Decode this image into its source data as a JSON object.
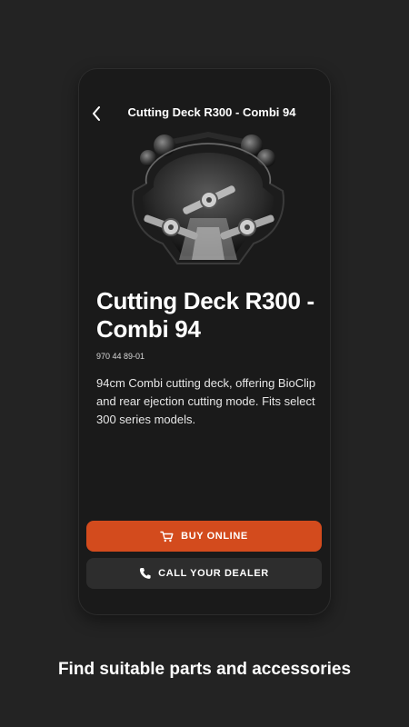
{
  "header": {
    "title": "Cutting Deck R300 - Combi 94"
  },
  "product": {
    "name": "Cutting Deck R300 - Combi 94",
    "number": "970 44 89-01",
    "description": "94cm Combi cutting deck, offering BioClip and rear ejection cutting mode. Fits select 300 series models.",
    "image_icon": "cutting-deck-image"
  },
  "actions": {
    "buy_label": "BUY ONLINE",
    "buy_icon": "cart-icon",
    "call_label": "CALL YOUR DEALER",
    "call_icon": "phone-icon"
  },
  "caption": "Find suitable parts and accessories",
  "colors": {
    "background": "#232323",
    "screen": "#1a1a1a",
    "accent": "#d34b1d",
    "secondary_button": "#2d2d2d"
  }
}
